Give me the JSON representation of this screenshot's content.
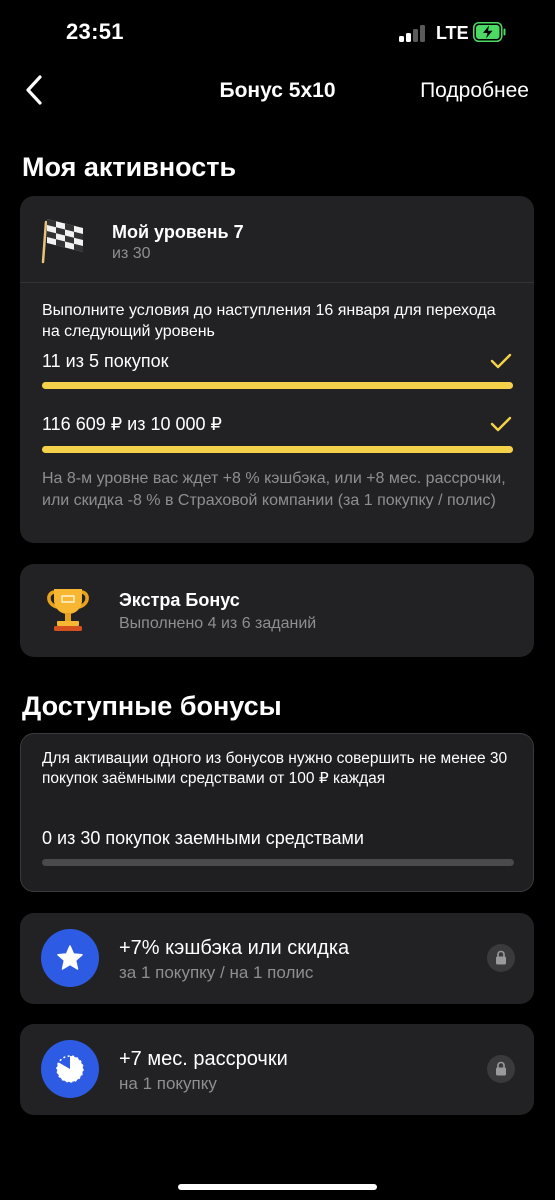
{
  "status_bar": {
    "time": "23:51",
    "network": "LTE"
  },
  "nav": {
    "title": "Бонус 5х10",
    "more_label": "Подробнее"
  },
  "activity": {
    "section_title": "Моя активность",
    "level": {
      "title": "Мой уровень 7",
      "subtitle": "из 30",
      "condition_text": "Выполните условия до наступления 16 января для перехода на следующий уровень",
      "goals": [
        {
          "label": "11 из 5 покупок",
          "progress": 1.0,
          "done": true
        },
        {
          "label": "116 609 ₽ из 10 000 ₽",
          "progress": 1.0,
          "done": true
        }
      ],
      "next_level_text": "На 8-м уровне вас ждет +8 % кэшбэка, или +8 мес. рассрочки, или скидка -8 % в Страховой компании (за 1 покупку / полис)"
    },
    "extra_bonus": {
      "title": "Экстра Бонус",
      "subtitle": "Выполнено 4 из 6 заданий"
    }
  },
  "available": {
    "section_title": "Доступные бонусы",
    "requirement_text": "Для активации одного из бонусов нужно совершить не менее 30 покупок заёмными средствами от 100 ₽ каждая",
    "progress_label": "0 из 30 покупок заемными средствами",
    "progress": 0.0,
    "bonuses": [
      {
        "title": "+7% кэшбэка или скидка",
        "subtitle": "за 1 покупку / на 1 полис",
        "icon": "star-icon",
        "locked": true
      },
      {
        "title": "+7 мес. рассрочки",
        "subtitle": "на 1 покупку",
        "icon": "timer-icon",
        "locked": true
      }
    ]
  },
  "colors": {
    "background": "#000000",
    "card": "#222224",
    "accent_yellow": "#f5d14a",
    "accent_blue": "#2d5be3",
    "battery_green": "#4cd964",
    "secondary_text": "#8e8e93"
  }
}
